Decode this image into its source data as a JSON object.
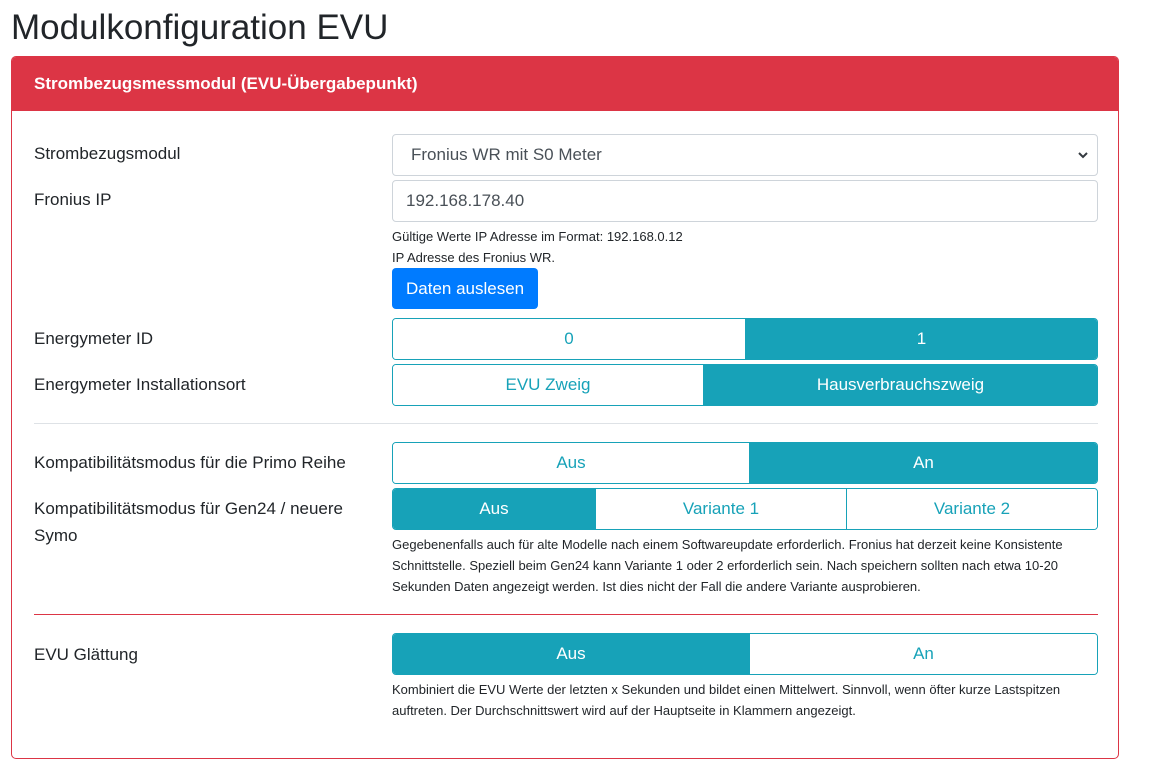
{
  "page": {
    "title": "Modulkonfiguration EVU"
  },
  "card": {
    "header": "Strombezugsmessmodul (EVU-Übergabepunkt)",
    "module": {
      "label": "Strombezugsmodul",
      "value": "Fronius WR mit S0 Meter"
    },
    "ip": {
      "label": "Fronius IP",
      "value": "192.168.178.40",
      "help1": "Gültige Werte IP Adresse im Format: 192.168.0.12",
      "help2": "IP Adresse des Fronius WR."
    },
    "read_button": "Daten auslesen",
    "energymeter_id": {
      "label": "Energymeter ID",
      "options": [
        "0",
        "1"
      ],
      "selected": "1"
    },
    "install_location": {
      "label": "Energymeter Installationsort",
      "options": [
        "EVU Zweig",
        "Hausverbrauchszweig"
      ],
      "selected": "Hausverbrauchszweig"
    },
    "primo_compat": {
      "label": "Kompatibilitätsmodus für die Primo Reihe",
      "options": [
        "Aus",
        "An"
      ],
      "selected": "An"
    },
    "gen24_compat": {
      "label": "Kompatibilitätsmodus für Gen24 / neuere Symo",
      "options": [
        "Aus",
        "Variante 1",
        "Variante 2"
      ],
      "selected": "Aus",
      "help": "Gegebenenfalls auch für alte Modelle nach einem Softwareupdate erforderlich. Fronius hat derzeit keine Konsistente Schnittstelle. Speziell beim Gen24 kann Variante 1 oder 2 erforderlich sein. Nach speichern sollten nach etwa 10-20 Sekunden Daten angezeigt werden. Ist dies nicht der Fall die andere Variante ausprobieren."
    },
    "smoothing": {
      "label": "EVU Glättung",
      "options": [
        "Aus",
        "An"
      ],
      "selected": "Aus",
      "help": "Kombiniert die EVU Werte der letzten x Sekunden und bildet einen Mittelwert. Sinnvoll, wenn öfter kurze Lastspitzen auftreten. Der Durchschnittswert wird auf der Hauptseite in Klammern angezeigt."
    }
  },
  "colors": {
    "danger": "#dc3545",
    "info": "#17a2b8",
    "primary": "#007bff"
  }
}
